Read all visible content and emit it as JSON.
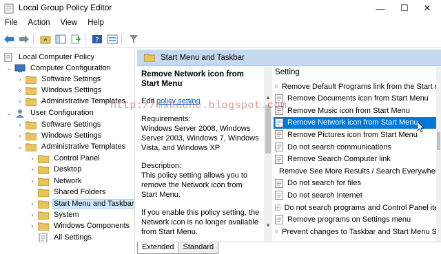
{
  "window": {
    "title": "Local Group Policy Editor",
    "minimize_glyph": "—",
    "maximize_glyph": "☐",
    "close_glyph": "✕"
  },
  "menu": [
    "File",
    "Action",
    "View",
    "Help"
  ],
  "tree": {
    "items": [
      {
        "label": "Local Computer Policy",
        "icon": "policy-icon"
      },
      {
        "label": "Computer Configuration",
        "icon": "computer-icon"
      },
      {
        "label": "Software Settings",
        "icon": "folder-icon"
      },
      {
        "label": "Windows Settings",
        "icon": "folder-icon"
      },
      {
        "label": "Administrative Templates",
        "icon": "folder-icon"
      },
      {
        "label": "User Configuration",
        "icon": "user-icon"
      },
      {
        "label": "Software Settings",
        "icon": "folder-icon"
      },
      {
        "label": "Windows Settings",
        "icon": "folder-icon"
      },
      {
        "label": "Administrative Templates",
        "icon": "folder-icon"
      },
      {
        "label": "Control Panel",
        "icon": "folder-icon"
      },
      {
        "label": "Desktop",
        "icon": "folder-icon"
      },
      {
        "label": "Network",
        "icon": "folder-icon"
      },
      {
        "label": "Shared Folders",
        "icon": "folder-icon"
      },
      {
        "label": "Start Menu and Taskbar",
        "icon": "folder-icon"
      },
      {
        "label": "System",
        "icon": "folder-icon"
      },
      {
        "label": "Windows Components",
        "icon": "folder-icon"
      },
      {
        "label": "All Settings",
        "icon": "settings-icon"
      }
    ]
  },
  "right": {
    "header": "Start Menu and Taskbar",
    "description": {
      "title": "Remove Network icon from Start Menu",
      "edit_prefix": "Edit ",
      "edit_link": "policy setting",
      "requirements_label": "Requirements:",
      "requirements_text": "Windows Server 2008, Windows Server 2003, Windows 7, Windows Vista, and Windows XP",
      "description_label": "Description:",
      "description_text": "This policy setting allows you to remove the Network icon from Start Menu.",
      "enable_text": "If you enable this policy setting, the Network icon is no longer available from Start Menu."
    },
    "list_header": "Setting",
    "settings": [
      "Remove Default Programs link from the Start m",
      "Remove Documents icon from Start Menu",
      "Remove Music icon from Start Menu",
      "Remove Network icon from Start Menu",
      "Remove Pictures icon from Start Menu",
      "Do not search communications",
      "Remove Search Computer link",
      "Remove See More Results / Search Everywhere",
      "Do not search for files",
      "Do not search Internet",
      "Do not search programs and Control Panel iter",
      "Remove programs on Settings menu",
      "Prevent changes to Taskbar and Start Menu Se"
    ],
    "selected_index": 3,
    "tabs": [
      "Extended",
      "Standard"
    ]
  },
  "watermark": "http://msbaohe.blogspot.com",
  "colors": {
    "header_bg": "#c5d9ef",
    "selection": "#0078d7",
    "tree_selection": "#cce8ff",
    "link": "#0066cc"
  }
}
